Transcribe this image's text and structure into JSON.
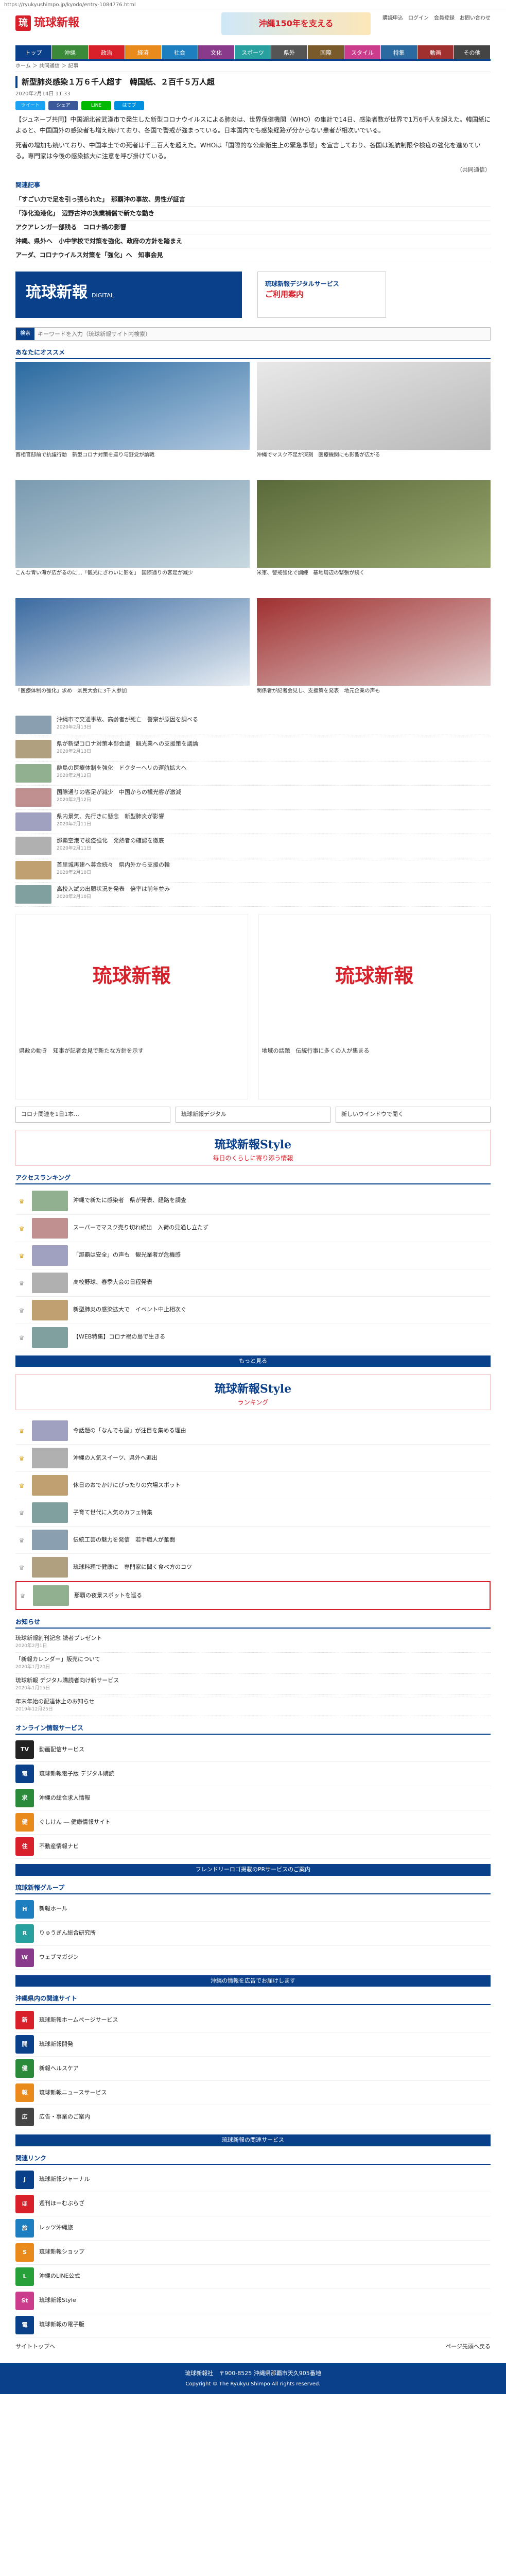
{
  "browser": {
    "url": "https://ryukyushimpo.jp/kyodo/entry-1084776.html"
  },
  "header": {
    "brand": "琉球新報",
    "brand_sub": "DIGITAL",
    "banner": "沖縄150年を支える",
    "links": [
      "購読申込",
      "ログイン",
      "会員登録",
      "お問い合わせ"
    ]
  },
  "nav": {
    "items": [
      "トップ",
      "沖縄",
      "政治",
      "経済",
      "社会",
      "文化",
      "スポーツ",
      "県外",
      "国際",
      "スタイル",
      "特集",
      "動画",
      "その他"
    ],
    "colors": [
      "#0a3f8a",
      "#3a8a3a",
      "#d7202a",
      "#e88b1c",
      "#1e7fc0",
      "#8a3a8a",
      "#28a0a0",
      "#555555",
      "#7a5a2a",
      "#cc3c8c",
      "#2a6aa0",
      "#a03030",
      "#444444"
    ]
  },
  "subnav": {
    "crumb": "ホーム ＞ 共同通信 ＞ 記事"
  },
  "article": {
    "title": "新型肺炎感染１万６千人超す　韓国紙、２百千５万人超",
    "date": "2020年2月14日 11:33",
    "share": [
      "ツイート",
      "シェア",
      "LINE",
      "はてブ"
    ],
    "p1": "【ジュネーブ共同】中国湖北省武漢市で発生した新型コロナウイルスによる肺炎は、世界保健機関（WHO）の集計で14日、感染者数が世界で1万6千人を超えた。韓国紙によると、中国国外の感染者も増え続けており、各国で警戒が強まっている。日本国内でも感染経路が分からない患者が相次いでいる。",
    "p2": "死者の増加も続いており、中国本土での死者は千三百人を超えた。WHOは「国際的な公衆衛生上の緊急事態」を宣言しており、各国は渡航制限や検疫の強化を進めている。専門家は今後の感染拡大に注意を呼び掛けている。",
    "credit": "（共同通信）",
    "related_head": "関連記事",
    "related": [
      "「すごい力で足を引っ張られた」　那覇沖の事故、男性が証言",
      "「浄化漁港化」　辺野古沖の漁業補償で新たな動き",
      "アクアレンガ一部残る　コロナ禍の影響",
      "沖縄、県外へ　小中学校で対策を強化、政府の方針を踏まえ",
      "アーダ、コロナウイルス対策を「強化」へ　知事会見"
    ]
  },
  "mid": {
    "logo": "琉球新報",
    "logo_sub": "DIGITAL",
    "ad1": "琉球新報デジタルサービス",
    "ad2": "ご利用案内"
  },
  "search": {
    "label": "検索",
    "placeholder": "キーワードを入力（琉球新報サイト内検索）"
  },
  "recommend": {
    "head": "あなたにオススメ",
    "photos": [
      {
        "cap": "首相官邸前で抗議行動　新型コロナ対策を巡り与野党が論戦",
        "c1": "#2a6aa0",
        "c2": "#b0c8e0"
      },
      {
        "cap": "沖縄でマスク不足が深刻　医療機関にも影響が広がる",
        "c1": "#e8e8e8",
        "c2": "#b8b8b8"
      },
      {
        "cap": "こんな青い海が広がるのに…「観光にぎわいに影を」　国際通りの客足が減少",
        "c1": "#7a9ab0",
        "c2": "#c8d8e0"
      },
      {
        "cap": "米軍、警戒強化で訓練　基地周辺の緊張が続く",
        "c1": "#5a6a3a",
        "c2": "#9aa870"
      },
      {
        "cap": "「医療体制の強化」求め　県民大会に3千人参加",
        "c1": "#3a6aa0",
        "c2": "#e8eef4"
      },
      {
        "cap": "関係者が記者会見し、支援策を発表　地元企業の声も",
        "c1": "#a03030",
        "c2": "#e0c8c8"
      }
    ],
    "texts": [
      {
        "t": "沖縄市で交通事故、高齢者が死亡　警察が原因を調べる",
        "d": "2020年2月13日"
      },
      {
        "t": "県が新型コロナ対策本部会議　観光業への支援策を議論",
        "d": "2020年2月13日"
      },
      {
        "t": "離島の医療体制を強化　ドクターヘリの運航拡大へ",
        "d": "2020年2月12日"
      },
      {
        "t": "国際通りの客足が減少　中国からの観光客が激減",
        "d": "2020年2月12日"
      },
      {
        "t": "県内景気、先行きに懸念　新型肺炎が影響",
        "d": "2020年2月11日"
      },
      {
        "t": "那覇空港で検疫強化　発熱者の確認を徹底",
        "d": "2020年2月11日"
      },
      {
        "t": "首里城再建へ募金続々　県内外から支援の輪",
        "d": "2020年2月10日"
      },
      {
        "t": "高校入試の出願状況を発表　倍率は前年並み",
        "d": "2020年2月10日"
      }
    ]
  },
  "tiles": {
    "logo": "琉球新報",
    "cap1": "県政の動き　知事が記者会見で新たな方針を示す",
    "cap2": "地域の話題　伝統行事に多くの人が集まる"
  },
  "tags": [
    "コロナ関連を1日1本…",
    "琉球新報デジタル",
    "新しいウインドウで開く"
  ],
  "style": {
    "title": "琉球新報Style",
    "sub": "毎日のくらしに寄り添う情報"
  },
  "access": {
    "head": "アクセスランキング",
    "items": [
      "沖縄で新たに感染者　県が発表、経路を調査",
      "スーパーでマスク売り切れ続出　入荷の見通し立たず",
      "「那覇は安全」の声も　観光業者が危機感",
      "高校野球、春季大会の日程発表",
      "新型肺炎の感染拡大で　イベント中止相次ぐ",
      "【WEB特集】コロナ禍の島で生きる"
    ]
  },
  "more": "もっと見る",
  "style2": {
    "title": "琉球新報Style",
    "sub": "ランキング"
  },
  "ranking": {
    "items": [
      "今話題の「なんでも屋」が注目を集める理由",
      "沖縄の人気スイーツ、県外へ進出",
      "休日のおでかけにぴったりの穴場スポット",
      "子育て世代に人気のカフェ特集",
      "伝統工芸の魅力を発信　若手職人が奮闘",
      "琉球料理で健康に　専門家に聞く食べ方のコツ",
      "那覇の夜景スポットを巡る"
    ]
  },
  "news": {
    "head": "お知らせ",
    "items": [
      {
        "t": "琉球新報創刊記念 読者プレゼント",
        "d": "2020年2月1日"
      },
      {
        "t": "「新報カレンダー」販売について",
        "d": "2020年1月20日"
      },
      {
        "t": "琉球新報 デジタル購読者向け新サービス",
        "d": "2020年1月15日"
      },
      {
        "t": "年末年始の配達休止のお知らせ",
        "d": "2019年12月25日"
      }
    ]
  },
  "services": {
    "head": "オンライン情報サービス",
    "items": [
      {
        "t": "動画配信サービス",
        "c": "#222222",
        "i": "TV"
      },
      {
        "t": "琉球新報電子版 デジタル購読",
        "c": "#0a3f8a",
        "i": "電"
      },
      {
        "t": "沖縄の総合求人情報",
        "c": "#2a8a3a",
        "i": "求"
      },
      {
        "t": "ぐしけん ― 健康情報サイト",
        "c": "#e88b1c",
        "i": "健"
      },
      {
        "t": "不動産情報ナビ",
        "c": "#d7202a",
        "i": "住"
      }
    ]
  },
  "bar1": "フレンドリーロゴ掲載のPRサービスのご案内",
  "groups": {
    "head": "琉球新報グループ",
    "items": [
      {
        "t": "新報ホール",
        "c": "#1e7fc0",
        "i": "H"
      },
      {
        "t": "りゅうぎん総合研究所",
        "c": "#28a0a0",
        "i": "R"
      },
      {
        "t": "ウェブマガジン",
        "c": "#8a3a8a",
        "i": "W"
      }
    ]
  },
  "bar2": "沖縄の情報を広告でお届けします",
  "partners": {
    "head": "沖縄県内の関連サイト",
    "items": [
      {
        "t": "琉球新報ホームページサービス",
        "c": "#d7202a",
        "i": "新"
      },
      {
        "t": "琉球新報開発",
        "c": "#0a3f8a",
        "i": "開"
      },
      {
        "t": "新報ヘルスケア",
        "c": "#2a8a3a",
        "i": "健"
      },
      {
        "t": "琉球新報ニュースサービス",
        "c": "#e88b1c",
        "i": "報"
      },
      {
        "t": "広告・事業のご案内",
        "c": "#444444",
        "i": "広"
      }
    ]
  },
  "bar3": "琉球新報の関連サービス",
  "extras": {
    "head": "関連リンク",
    "items": [
      {
        "t": "琉球新報ジャーナル",
        "c": "#0a3f8a",
        "i": "J"
      },
      {
        "t": "週刊ほーむぷらざ",
        "c": "#d7202a",
        "i": "ほ"
      },
      {
        "t": "レッツ沖縄旅",
        "c": "#1e7fc0",
        "i": "旅"
      },
      {
        "t": "琉球新報ショップ",
        "c": "#e88b1c",
        "i": "S"
      },
      {
        "t": "沖縄のLINE公式",
        "c": "#28a03a",
        "i": "L"
      },
      {
        "t": "琉球新報Style",
        "c": "#cc3c8c",
        "i": "St"
      },
      {
        "t": "琉球新報の電子版",
        "c": "#0a3f8a",
        "i": "電"
      }
    ]
  },
  "pagetop": {
    "left": "サイトトップへ",
    "right": "ページ先頭へ戻る"
  },
  "footer": {
    "line1": "琉球新報社　〒900-8525 沖縄県那覇市天久905番地",
    "line2": "Copyright © The Ryukyu Shimpo All rights reserved."
  }
}
